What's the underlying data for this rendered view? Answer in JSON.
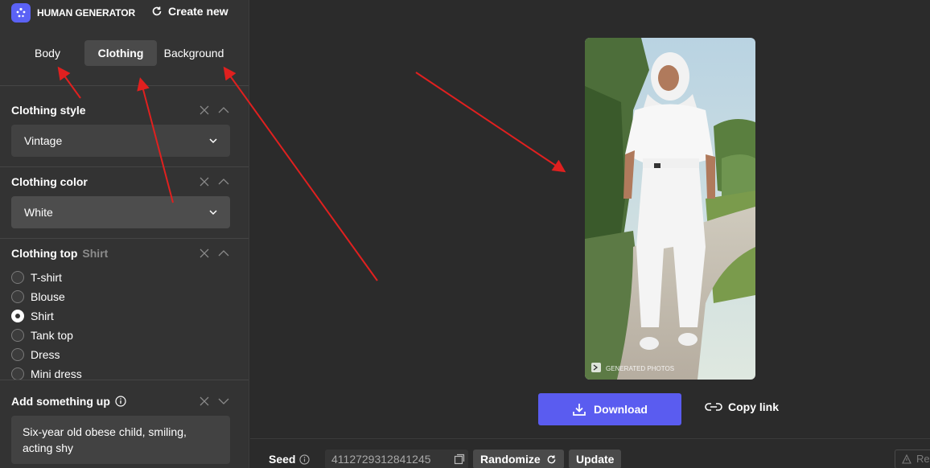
{
  "brand": {
    "name": "HUMAN GENERATOR"
  },
  "header": {
    "create_new": "Create new"
  },
  "tabs": [
    {
      "label": "Body"
    },
    {
      "label": "Clothing",
      "active": true
    },
    {
      "label": "Background"
    }
  ],
  "clothing_style": {
    "title": "Clothing style",
    "value": "Vintage"
  },
  "clothing_color": {
    "title": "Clothing color",
    "value": "White"
  },
  "clothing_top": {
    "title": "Clothing top",
    "selected_hint": "Shirt",
    "options": [
      {
        "label": "T-shirt",
        "checked": false
      },
      {
        "label": "Blouse",
        "checked": false
      },
      {
        "label": "Shirt",
        "checked": true
      },
      {
        "label": "Tank top",
        "checked": false
      },
      {
        "label": "Dress",
        "checked": false
      },
      {
        "label": "Mini dress",
        "checked": false
      }
    ]
  },
  "add_something": {
    "title": "Add something up",
    "text": "Six-year old obese child, smiling, acting shy"
  },
  "preview": {
    "watermark": "GENERATED PHOTOS"
  },
  "actions": {
    "download": "Download",
    "copy_link": "Copy link"
  },
  "seed": {
    "label": "Seed",
    "value": "4112729312841245",
    "randomize": "Randomize",
    "update": "Update",
    "report_partial": "Re"
  },
  "colors": {
    "accent": "#5a5cf0",
    "annotation_arrow": "#e0201f",
    "sidebar_bg": "#333333",
    "main_bg": "#2b2b2b"
  }
}
